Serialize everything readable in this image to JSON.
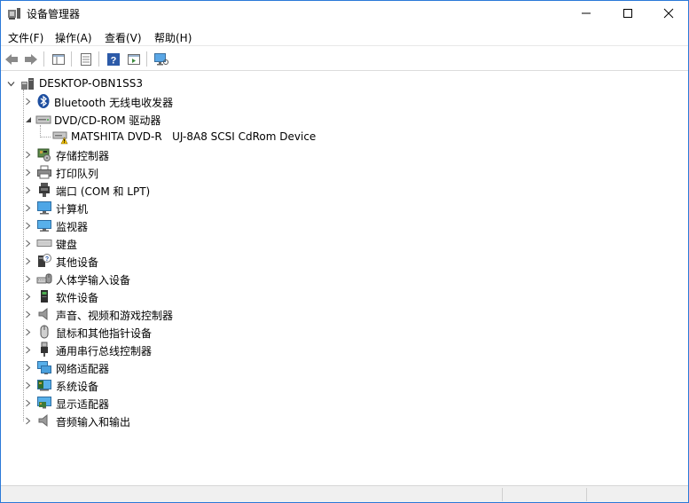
{
  "window": {
    "title": "设备管理器"
  },
  "menu": [
    "文件(F)",
    "操作(A)",
    "查看(V)",
    "帮助(H)"
  ],
  "toolbar_icons": [
    "back-arrow-icon",
    "forward-arrow-icon",
    "show-hide-tree-icon",
    "properties-icon",
    "help-icon",
    "action-pane-icon",
    "scan-hardware-icon"
  ],
  "tree": {
    "root": "DESKTOP-OBN1SS3",
    "bluetooth": "Bluetooth 无线电收发器",
    "dvd": "DVD/CD-ROM 驱动器",
    "dvd_child": "MATSHITA DVD-R   UJ-8A8 SCSI CdRom Device",
    "storage": "存储控制器",
    "print_queue": "打印队列",
    "ports": "端口 (COM 和 LPT)",
    "computer": "计算机",
    "monitors": "监视器",
    "keyboard": "键盘",
    "other_devices": "其他设备",
    "hid": "人体学输入设备",
    "software_devices": "软件设备",
    "sound": "声音、视频和游戏控制器",
    "mice": "鼠标和其他指针设备",
    "usb": "通用串行总线控制器",
    "network": "网络适配器",
    "system": "系统设备",
    "display": "显示适配器",
    "audio_io": "音频输入和输出"
  }
}
